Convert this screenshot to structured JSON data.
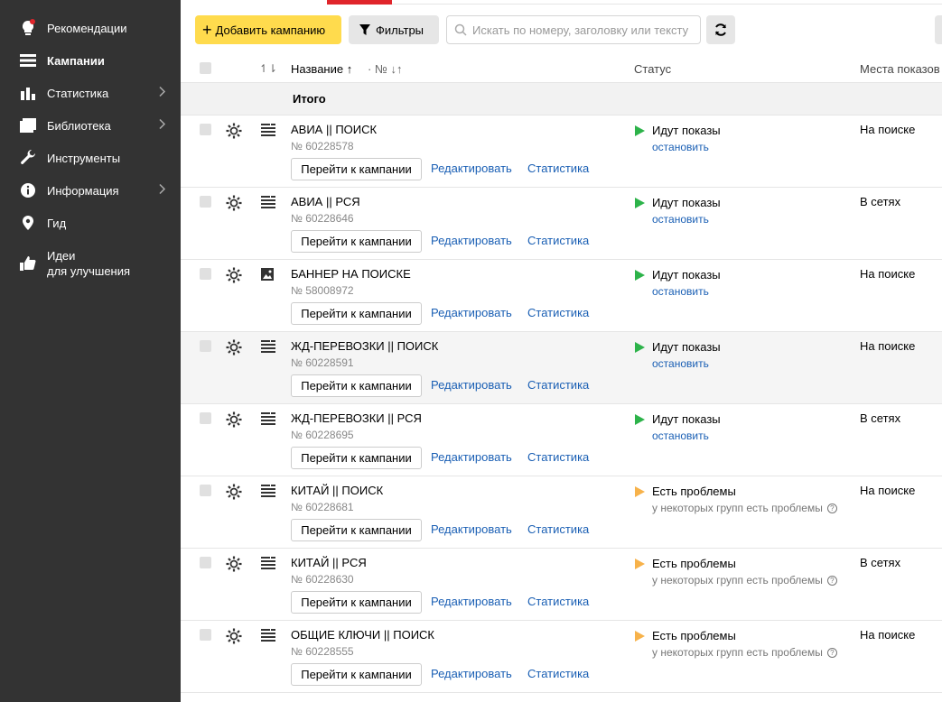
{
  "sidebar": {
    "items": [
      {
        "label": "Рекомендации",
        "icon": "lightbulb-icon",
        "chevron": false
      },
      {
        "label": "Кампании",
        "icon": "list-icon",
        "chevron": false,
        "active": true
      },
      {
        "label": "Статистика",
        "icon": "bar-chart-icon",
        "chevron": true
      },
      {
        "label": "Библиотека",
        "icon": "library-icon",
        "chevron": true
      },
      {
        "label": "Инструменты",
        "icon": "wrench-icon",
        "chevron": false
      },
      {
        "label": "Информация",
        "icon": "info-icon",
        "chevron": true
      },
      {
        "label": "Гид",
        "icon": "guide-icon",
        "chevron": false
      },
      {
        "label_line1": "Идеи",
        "label_line2": "для улучшения",
        "icon": "thumbs-up-icon",
        "chevron": false
      }
    ]
  },
  "toolbar": {
    "add_label": "Добавить кампанию",
    "filters_label": "Фильтры",
    "search_placeholder": "Искать по номеру, заголовку или тексту"
  },
  "table": {
    "header": {
      "sort_icon": "↿⇂",
      "name": "Название ↑",
      "num": "· № ↓↑",
      "status": "Статус",
      "places": "Места показов"
    },
    "totals_label": "Итого",
    "rows": [
      {
        "name": "АВИА || ПОИСК",
        "num": "№ 60228578",
        "type": "text",
        "status": "Идут показы",
        "status_kind": "ok",
        "sub": "остановить",
        "place": "На поиске"
      },
      {
        "name": "АВИА || РСЯ",
        "num": "№ 60228646",
        "type": "text",
        "status": "Идут показы",
        "status_kind": "ok",
        "sub": "остановить",
        "place": "В сетях"
      },
      {
        "name": "БАННЕР НА ПОИСКЕ",
        "num": "№ 58008972",
        "type": "image",
        "status": "Идут показы",
        "status_kind": "ok",
        "sub": "остановить",
        "place": "На поиске"
      },
      {
        "name": "ЖД-ПЕРЕВОЗКИ || ПОИСК",
        "num": "№ 60228591",
        "type": "text",
        "status": "Идут показы",
        "status_kind": "ok",
        "sub": "остановить",
        "place": "На поиске",
        "hl": true
      },
      {
        "name": "ЖД-ПЕРЕВОЗКИ || РСЯ",
        "num": "№ 60228695",
        "type": "text",
        "status": "Идут показы",
        "status_kind": "ok",
        "sub": "остановить",
        "place": "В сетях"
      },
      {
        "name": "КИТАЙ || ПОИСК",
        "num": "№ 60228681",
        "type": "text",
        "status": "Есть проблемы",
        "status_kind": "warn",
        "sub": "у некоторых групп есть проблемы",
        "place": "На поиске"
      },
      {
        "name": "КИТАЙ || РСЯ",
        "num": "№ 60228630",
        "type": "text",
        "status": "Есть проблемы",
        "status_kind": "warn",
        "sub": "у некоторых групп есть проблемы",
        "place": "В сетях"
      },
      {
        "name": "ОБЩИЕ КЛЮЧИ || ПОИСК",
        "num": "№ 60228555",
        "type": "text",
        "status": "Есть проблемы",
        "status_kind": "warn",
        "sub": "у некоторых групп есть проблемы",
        "place": "На поиске"
      }
    ],
    "goto_label": "Перейти к кампании",
    "edit_label": "Редактировать",
    "stat_label": "Статистика"
  },
  "colors": {
    "sidebar": "#333333",
    "accent": "#ffdb4d",
    "ok": "#2db34a",
    "warn": "#f7b24a",
    "link": "#1a5fb4"
  }
}
